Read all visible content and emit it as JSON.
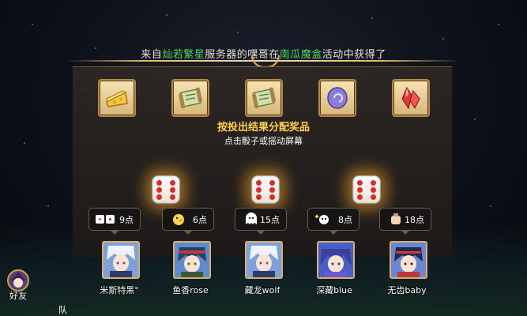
{
  "header": {
    "prefix": "来自",
    "server": "灿若繁星",
    "mid1": "服务器的",
    "owner": "嘿哥",
    "mid2": "在",
    "activity": "南瓜魔盒",
    "suffix": "活动中获得了"
  },
  "rewards": [
    {
      "icon": "cheese-icon"
    },
    {
      "icon": "scroll-icon"
    },
    {
      "icon": "scroll-icon"
    },
    {
      "icon": "purple-stone-icon"
    },
    {
      "icon": "red-crystal-icon"
    }
  ],
  "instructions": {
    "line1": "按投出结果分配奖品",
    "line2": "点击骰子或摇动屏幕"
  },
  "players": [
    {
      "name": "米斯特黑°",
      "points": "9点"
    },
    {
      "name": "鱼香rose",
      "points": "6点"
    },
    {
      "name": "藏龙wolf",
      "points": "15点"
    },
    {
      "name": "深藏blue",
      "points": "8点"
    },
    {
      "name": "无齿baby",
      "points": "18点"
    }
  ],
  "sidebar": {
    "friends_label": "好友",
    "team_label": "队"
  },
  "colors": {
    "highlight_green": "#4fd35f",
    "instruction_gold": "#ffcf4d",
    "dice_pip": "#e02b2b"
  }
}
